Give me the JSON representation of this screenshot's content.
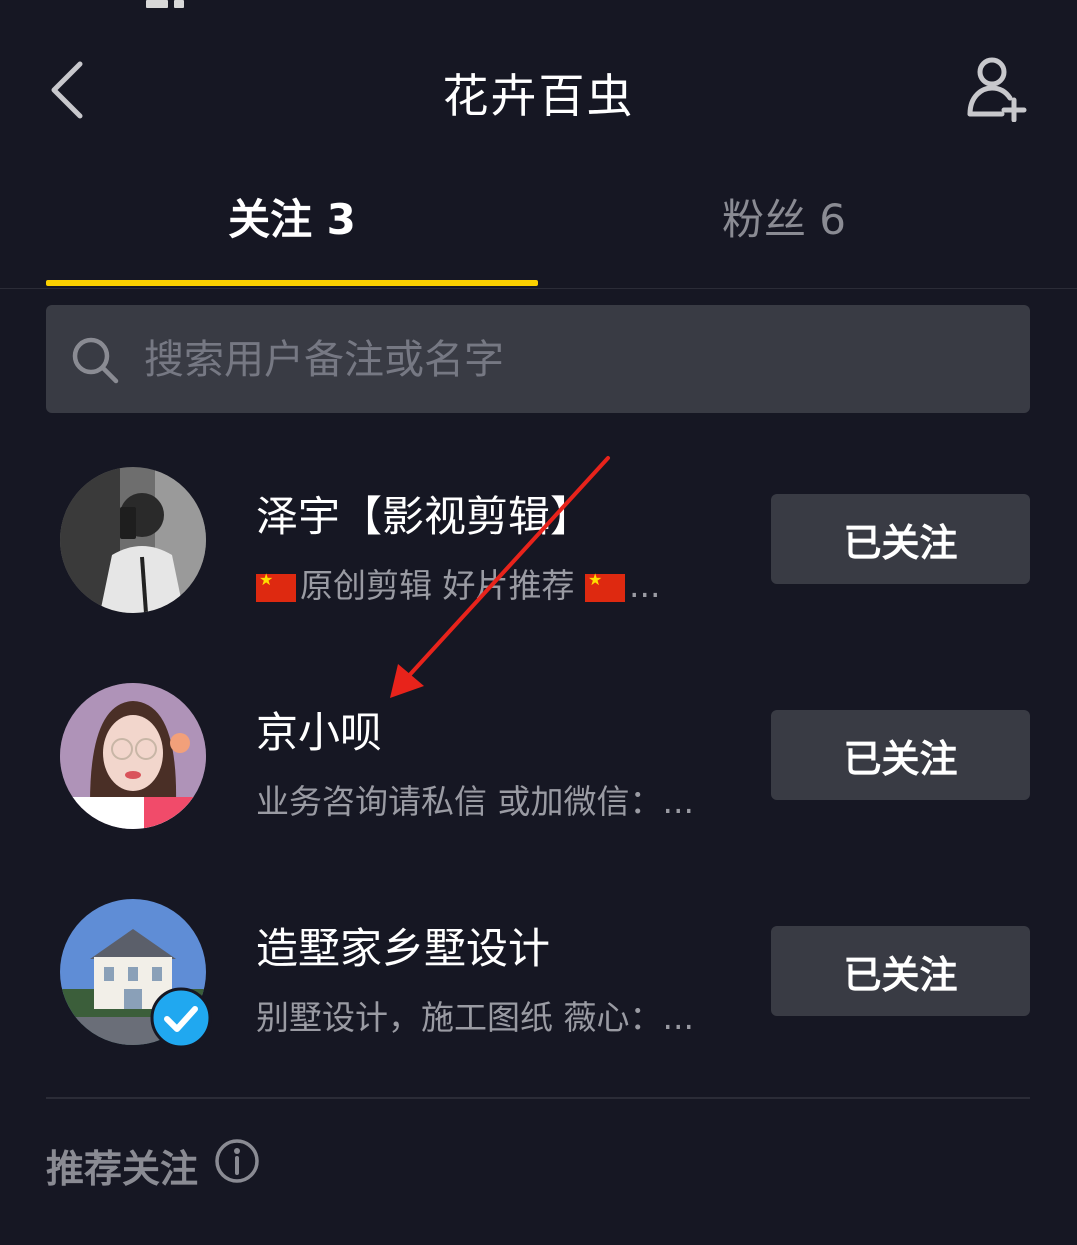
{
  "header": {
    "title": "花卉百虫",
    "back_icon": "chevron-left-icon",
    "add_friend_icon": "add-user-icon"
  },
  "tabs": [
    {
      "label": "关注 3",
      "active": true
    },
    {
      "label": "粉丝 6",
      "active": false
    }
  ],
  "colors": {
    "background": "#161723",
    "accent": "#fbd100",
    "button_bg": "#393b44",
    "verified": "#20a8f0",
    "annotation_arrow": "#e8231b"
  },
  "search": {
    "placeholder": "搜索用户备注或名字",
    "value": "",
    "icon": "search-icon"
  },
  "following": [
    {
      "name": "泽宇【影视剪辑】",
      "bio": "原创剪辑  好片推荐  ",
      "bio_has_flags": true,
      "button": "已关注",
      "verified": false
    },
    {
      "name": "京小呗",
      "bio": "业务咨询请私信 或加微信：...",
      "button": "已关注",
      "verified": false
    },
    {
      "name": "造墅家乡墅设计",
      "bio": "别墅设计，施工图纸 薇心：...",
      "button": "已关注",
      "verified": true
    }
  ],
  "recommend": {
    "title": "推荐关注",
    "icon": "info-icon"
  }
}
